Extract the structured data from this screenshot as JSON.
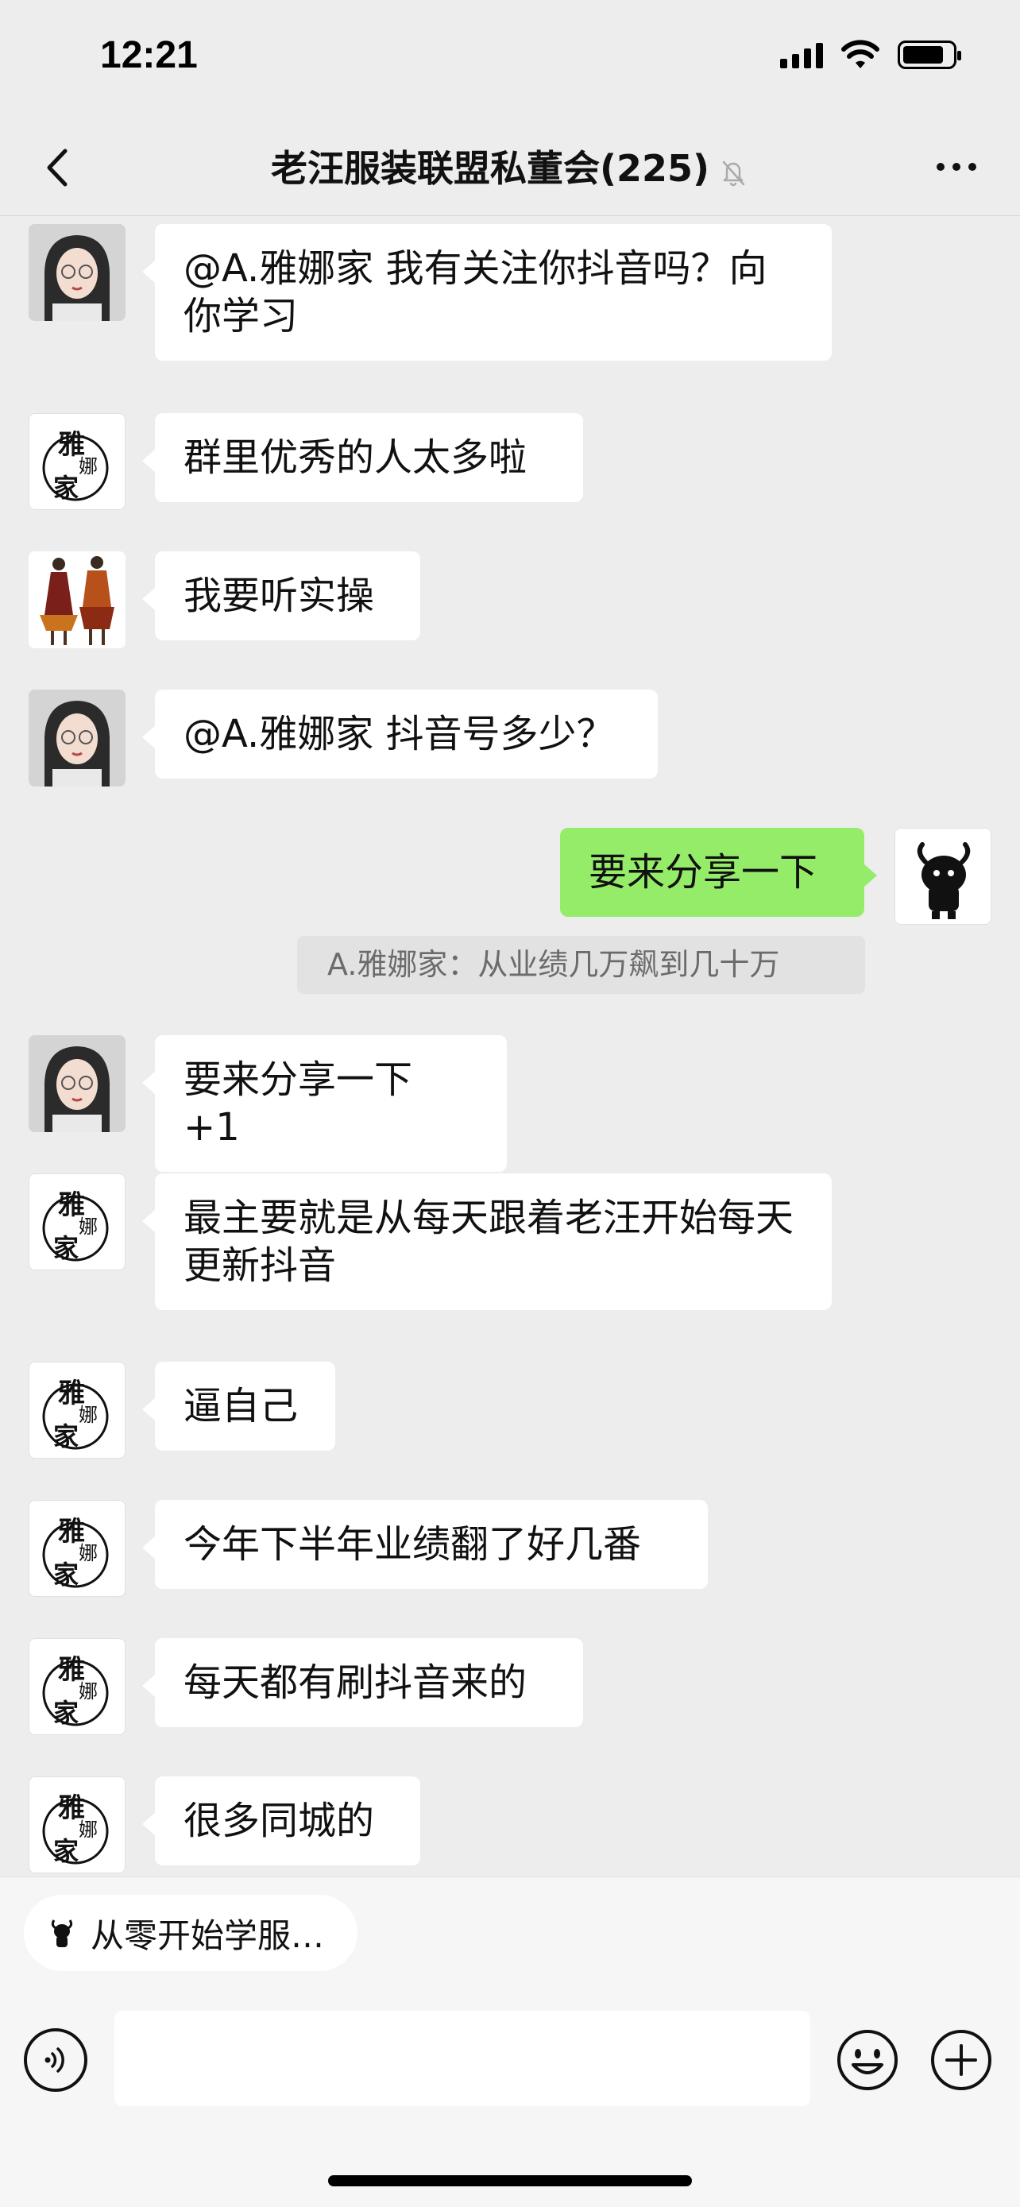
{
  "status_bar": {
    "time": "12:21"
  },
  "header": {
    "title": "老汪服装联盟私董会(225)"
  },
  "messages": [
    {
      "sender": "woman",
      "text": "@A.雅娜家 我有关注你抖音吗？向你学习"
    },
    {
      "sender": "yana",
      "text": "群里优秀的人太多啦"
    },
    {
      "sender": "fashion",
      "text": "我要听实操"
    },
    {
      "sender": "woman",
      "text": "@A.雅娜家 抖音号多少？"
    },
    {
      "sender": "self",
      "text": "要来分享一下"
    },
    {
      "sender": "woman",
      "text": "要来分享一下 +1"
    },
    {
      "sender": "yana",
      "text": "最主要就是从每天跟着老汪开始每天更新抖音"
    },
    {
      "sender": "yana",
      "text": "逼自己"
    },
    {
      "sender": "yana",
      "text": "今年下半年业绩翻了好几番"
    },
    {
      "sender": "yana",
      "text": "每天都有刷抖音来的"
    },
    {
      "sender": "yana",
      "text": "很多同城的"
    }
  ],
  "quote": {
    "text": "A.雅娜家：从业绩几万飙到几十万"
  },
  "avatars": {
    "yana_text": "雅娜家"
  },
  "bottom": {
    "chip_label": "从零开始学服…",
    "input_value": ""
  },
  "colors": {
    "background": "#ededed",
    "self_bubble": "#95ec69",
    "other_bubble": "#ffffff"
  }
}
